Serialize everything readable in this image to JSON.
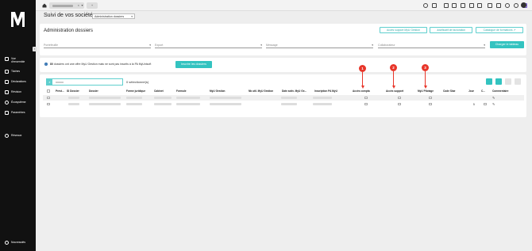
{
  "sidebar": {
    "items": [
      {
        "label": "Vue\nd'ensemble",
        "icon": "grid-icon"
      },
      {
        "label": "Tâches",
        "icon": "tasks-icon"
      },
      {
        "label": "Déclarations",
        "icon": "document-icon"
      },
      {
        "label": "Révision",
        "icon": "review-icon"
      },
      {
        "label": "Écosystème",
        "icon": "ecosystem-icon"
      },
      {
        "label": "Paramètres",
        "icon": "settings-icon"
      },
      {
        "label": "Réseaux",
        "icon": "network-icon"
      }
    ],
    "bottom_item": {
      "label": "Nouveautés",
      "icon": "news-icon"
    }
  },
  "topbar": {
    "new_tab_label": "+"
  },
  "header": {
    "title": "Suivi de vos sociétés",
    "view_select": "Administration dossiers"
  },
  "admin": {
    "title": "Administration dossiers",
    "actions": [
      {
        "label": "Accès support MyU Gestion"
      },
      {
        "label": "Justificatif de facturation"
      },
      {
        "label": "Catalogue de formations"
      }
    ],
    "filters": [
      {
        "placeholder": "Portefeuille"
      },
      {
        "placeholder": "Export"
      },
      {
        "placeholder": "Message"
      },
      {
        "placeholder": "Collaborateur"
      }
    ],
    "load_button": "Charger le tableau"
  },
  "info_banner": {
    "count": "80",
    "text": "dossiers ont une offre MyU Gestion mais ne sont pas inscrits à la PA MyUnisoft",
    "button": "Inscrire les dossiers"
  },
  "table": {
    "selected_text": "0 sélectionné(s)",
    "columns": [
      "Prest...",
      "ID Dossier",
      "Dossier",
      "Forme juridique",
      "Cabinet",
      "Formule",
      "MyU Gestion",
      "Nb util. MyU Gestion",
      "Date activ. MyU Ge...",
      "Inscription PA MyU",
      "Accès compta",
      "Accès support",
      "MyU Pilotage",
      "Code Siae",
      "Jour",
      "C...",
      "Commentaire"
    ],
    "rows": [
      {
        "jour": "",
        "edit": "✎"
      },
      {
        "jour": "5",
        "edit": "✎"
      }
    ]
  },
  "annotations": [
    "1",
    "2",
    "3"
  ],
  "colors": {
    "accent": "#33c3c0",
    "annotation": "#e8362a",
    "sidebar": "#111111"
  }
}
